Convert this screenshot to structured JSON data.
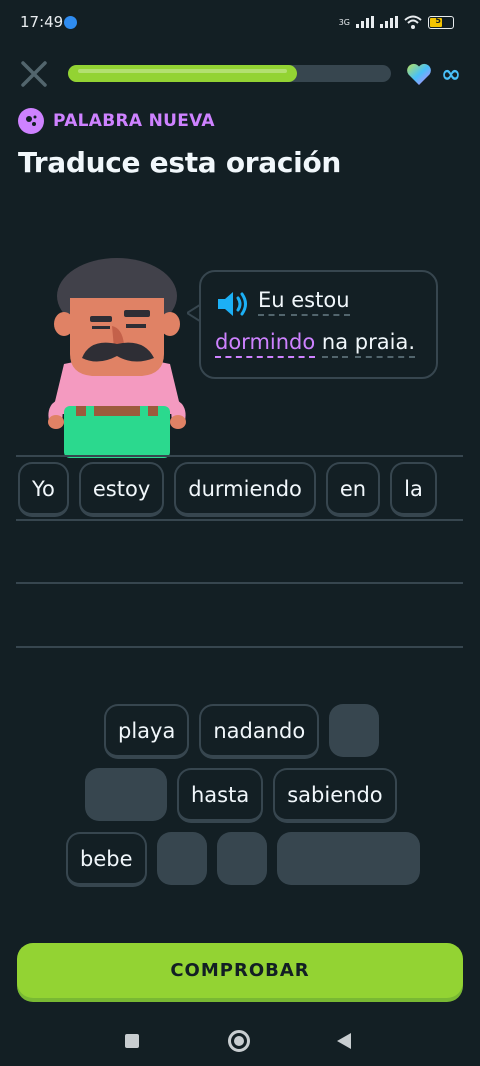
{
  "status_bar": {
    "time": "17:49",
    "network": "3G",
    "battery": "51"
  },
  "top_bar": {
    "progress": 0.71,
    "hearts": "infinite",
    "infinity_symbol": "∞"
  },
  "header": {
    "badge": "PALABRA NUEVA",
    "title": "Traduce esta oración"
  },
  "prompt": {
    "line1": [
      "Eu",
      "estou"
    ],
    "line2_new_word": "dormindo",
    "line2_rest": [
      "na",
      "praia."
    ]
  },
  "answer": {
    "words": [
      "Yo",
      "estoy",
      "durmiendo",
      "en",
      "la"
    ]
  },
  "word_bank": {
    "row1": [
      "playa",
      "nadando"
    ],
    "row2": [
      "hasta",
      "sabiendo"
    ],
    "row3": [
      "bebe"
    ]
  },
  "check_button": "COMPROBAR",
  "colors": {
    "background": "#131f24",
    "accent_green": "#93d333",
    "accent_purple": "#ce82ff",
    "accent_blue": "#49c0f8",
    "tile_border": "#37464f"
  },
  "icons": [
    "close-icon",
    "heart-icon",
    "infinity-icon",
    "new-word-icon",
    "speaker-icon",
    "nav-recents-icon",
    "nav-home-icon",
    "nav-back-icon"
  ]
}
